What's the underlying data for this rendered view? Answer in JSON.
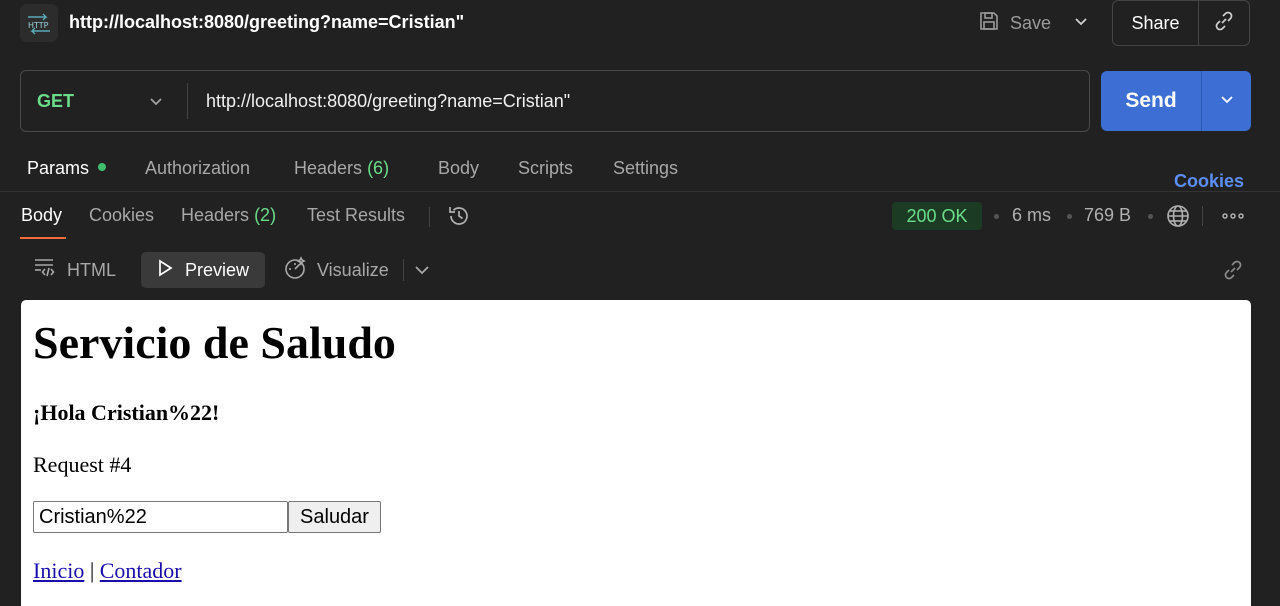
{
  "request": {
    "title": "http://localhost:8080/greeting?name=Cristian\"",
    "method": "GET",
    "url": "http://localhost:8080/greeting?name=Cristian\"",
    "badge_icon": "http-icon"
  },
  "toolbar": {
    "save_label": "Save",
    "share_label": "Share",
    "send_label": "Send"
  },
  "request_tabs": [
    {
      "label": "Params",
      "active": true,
      "dot": true
    },
    {
      "label": "Authorization"
    },
    {
      "label": "Headers",
      "count": "(6)"
    },
    {
      "label": "Body"
    },
    {
      "label": "Scripts"
    },
    {
      "label": "Settings"
    }
  ],
  "cookies_link": "Cookies",
  "response_tabs": [
    {
      "label": "Body",
      "active": true
    },
    {
      "label": "Cookies"
    },
    {
      "label": "Headers",
      "count": "(2)"
    },
    {
      "label": "Test Results"
    }
  ],
  "response_meta": {
    "status": "200 OK",
    "time": "6 ms",
    "size": "769 B"
  },
  "view_modes": {
    "html": "HTML",
    "preview": "Preview",
    "visualize": "Visualize"
  },
  "preview_page": {
    "heading": "Servicio de Saludo",
    "greeting": "¡Hola Cristian%22!",
    "request_count": "Request #4",
    "input_value": "Cristian%22",
    "button_label": "Saludar",
    "links": [
      "Inicio",
      "Contador"
    ],
    "link_separator": "|"
  },
  "colors": {
    "background": "#212121",
    "accent_send": "#3c6ed4",
    "method_get": "#6bdd8a",
    "status_ok_bg": "#1c3b24",
    "cookies_link": "#5c8ef5",
    "active_tab_underline": "#f26b3a"
  }
}
